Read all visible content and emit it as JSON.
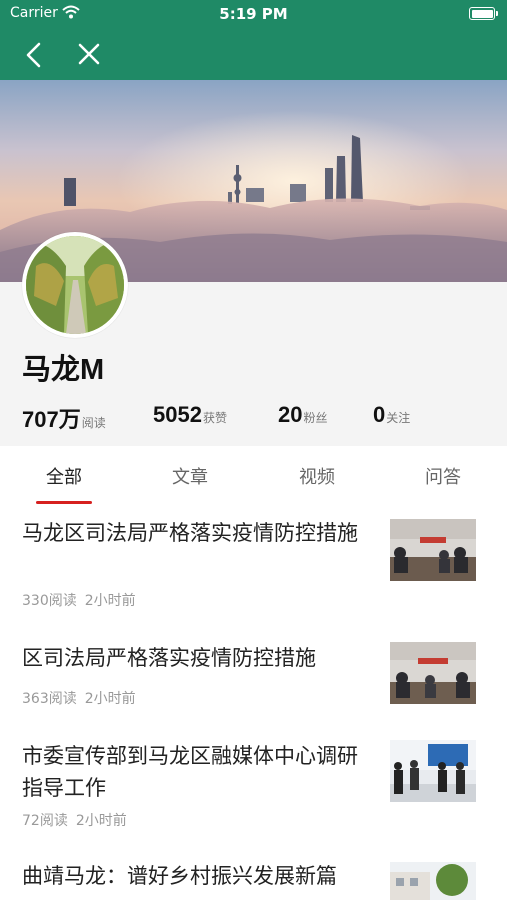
{
  "status_bar": {
    "carrier": "Carrier",
    "time": "5:19 PM"
  },
  "nav": {
    "back_icon": "chevron-left-icon",
    "close_icon": "close-icon"
  },
  "profile": {
    "name": "马龙M",
    "stats": [
      {
        "value": "707万",
        "label": "阅读"
      },
      {
        "value": "5052",
        "label": "获赞"
      },
      {
        "value": "20",
        "label": "粉丝"
      },
      {
        "value": "0",
        "label": "关注"
      }
    ]
  },
  "tabs": [
    {
      "label": "全部",
      "active": true
    },
    {
      "label": "文章",
      "active": false
    },
    {
      "label": "视频",
      "active": false
    },
    {
      "label": "问答",
      "active": false
    }
  ],
  "articles": [
    {
      "title": "马龙区司法局严格落实疫情防控措施",
      "reads": "330阅读",
      "time": "2小时前"
    },
    {
      "title": "区司法局严格落实疫情防控措施",
      "reads": "363阅读",
      "time": "2小时前"
    },
    {
      "title": "市委宣传部到马龙区融媒体中心调研指导工作",
      "reads": "72阅读",
      "time": "2小时前"
    },
    {
      "title": "曲靖马龙：谱好乡村振兴发展新篇",
      "reads": "",
      "time": ""
    }
  ],
  "colors": {
    "nav": "#1f8a66",
    "accent": "#d6201f",
    "profile_bg": "#f4f4f4"
  }
}
